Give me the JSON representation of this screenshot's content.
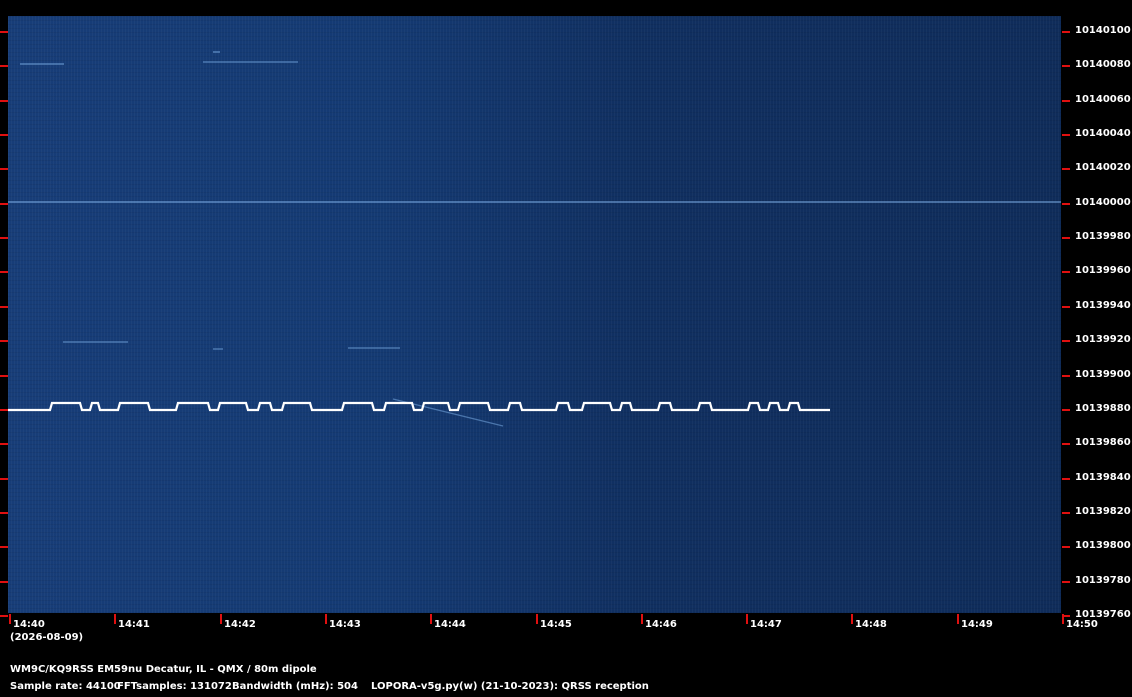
{
  "waterfall": {
    "freq_ticks": [
      "10140100",
      "10140080",
      "10140060",
      "10140040",
      "10140020",
      "10140000",
      "10139980",
      "10139960",
      "10139940",
      "10139920",
      "10139900",
      "10139880",
      "10139860",
      "10139840",
      "10139820",
      "10139800",
      "10139780",
      "10139760"
    ],
    "time_ticks": [
      "14:40",
      "14:41",
      "14:42",
      "14:43",
      "14:44",
      "14:45",
      "14:46",
      "14:47",
      "14:48",
      "14:49",
      "14:50"
    ],
    "date": "(2026-08-09)"
  },
  "footer": {
    "station": "WM9C/KQ9RSS EM59nu Decatur, IL - QMX / 80m dipole",
    "sample_rate": "Sample rate: 44100",
    "fft": "FFTsamples: 131072",
    "bandwidth": "Bandwidth (mHz): 504",
    "software": "LOPORA-v5g.py(w) (21-10-2023): QRSS reception"
  },
  "colors": {
    "background": "#000000",
    "waterfall": "#143a73",
    "tick": "#e01010",
    "signal": "#ffffff"
  }
}
